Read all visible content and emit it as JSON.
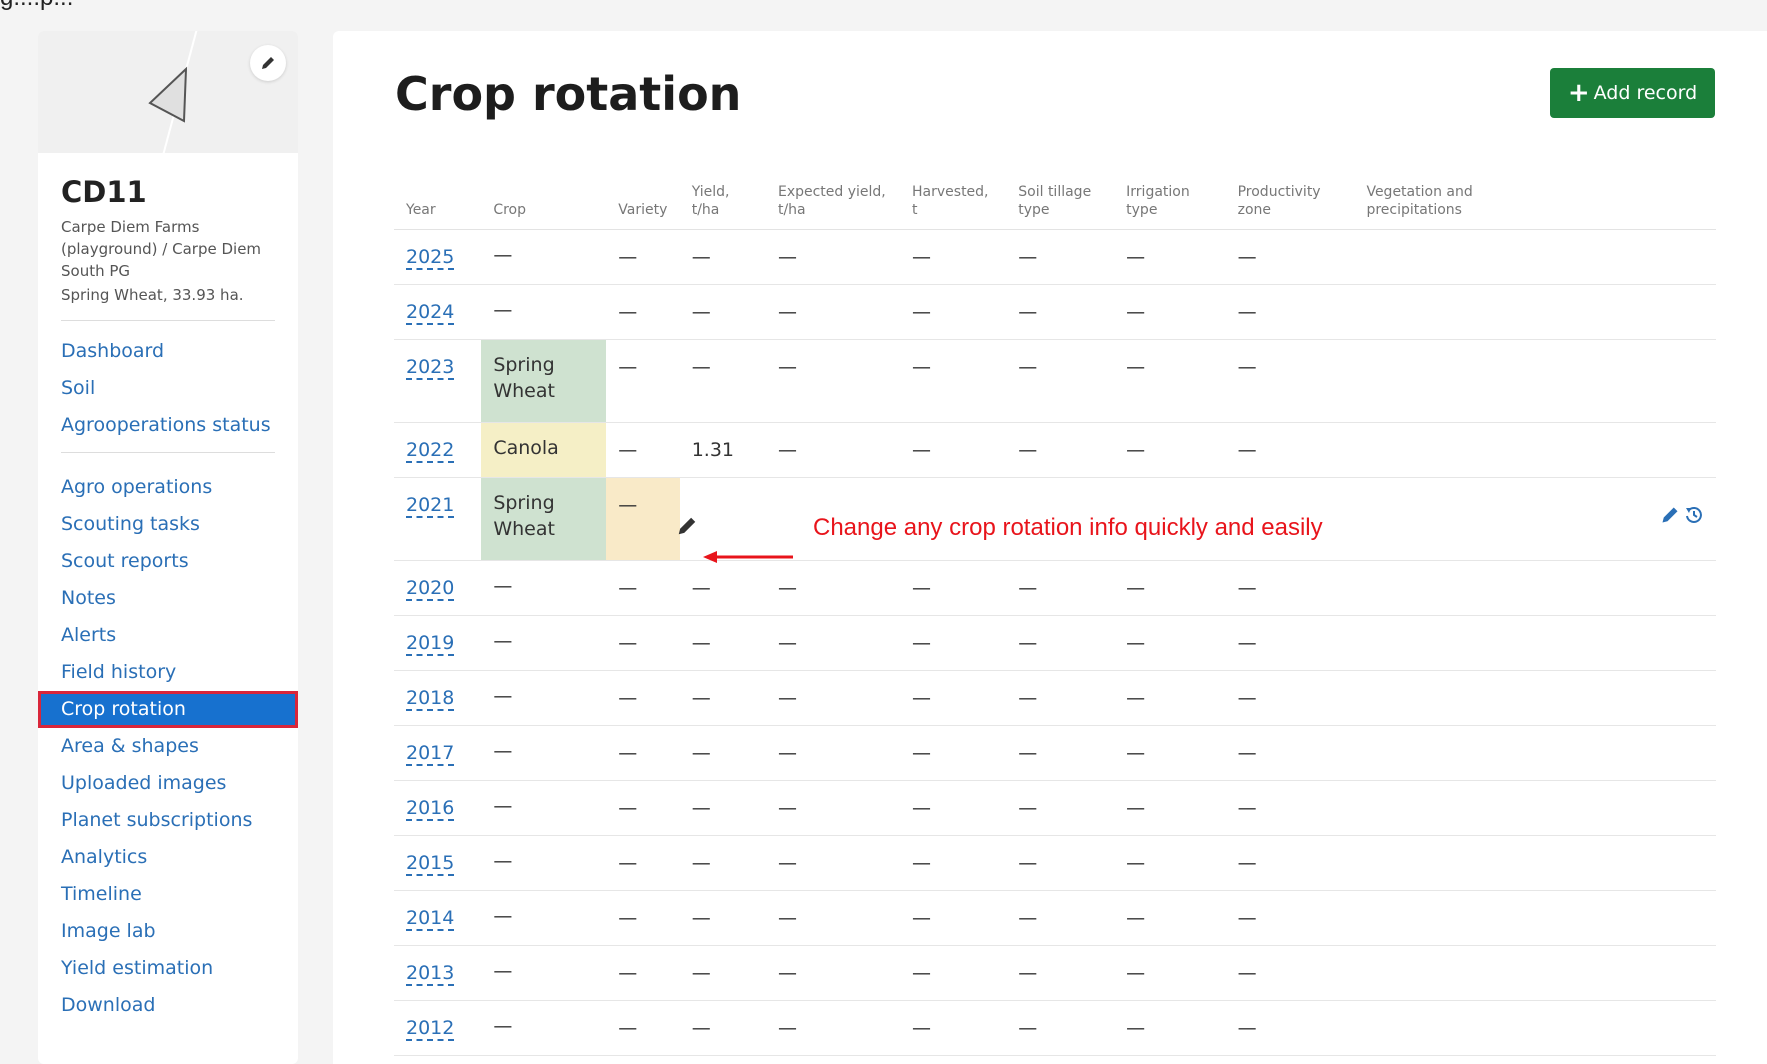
{
  "top_clip": "g....p...",
  "sidebar": {
    "field_name": "CD11",
    "meta_line1": "Carpe Diem Farms",
    "meta_line2": "(playground) / Carpe Diem",
    "meta_line3": "South PG",
    "meta_line4": "Spring Wheat, 33.93 ha.",
    "group1": [
      {
        "label": "Dashboard"
      },
      {
        "label": "Soil"
      },
      {
        "label": "Agrooperations status"
      }
    ],
    "group2": [
      {
        "label": "Agro operations"
      },
      {
        "label": "Scouting tasks"
      },
      {
        "label": "Scout reports"
      },
      {
        "label": "Notes"
      },
      {
        "label": "Alerts"
      },
      {
        "label": "Field history"
      },
      {
        "label": "Crop rotation",
        "active": true
      },
      {
        "label": "Area & shapes"
      },
      {
        "label": "Uploaded images"
      },
      {
        "label": "Planet subscriptions"
      },
      {
        "label": "Analytics"
      },
      {
        "label": "Timeline"
      },
      {
        "label": "Image lab"
      },
      {
        "label": "Yield estimation"
      },
      {
        "label": "Download"
      }
    ]
  },
  "main": {
    "title": "Crop rotation",
    "add_button": "Add record",
    "annotation": "Change any crop rotation info quickly and easily",
    "columns": [
      {
        "l1": "",
        "l2": "Year"
      },
      {
        "l1": "",
        "l2": "Crop"
      },
      {
        "l1": "",
        "l2": "Variety"
      },
      {
        "l1": "Yield,",
        "l2": "t/ha"
      },
      {
        "l1": "Expected yield,",
        "l2": "t/ha"
      },
      {
        "l1": "Harvested,",
        "l2": "t"
      },
      {
        "l1": "Soil tillage",
        "l2": "type"
      },
      {
        "l1": "Irrigation",
        "l2": "type"
      },
      {
        "l1": "Productivity",
        "l2": "zone"
      },
      {
        "l1": "Vegetation and",
        "l2": "precipitations"
      }
    ],
    "rows": [
      {
        "year": "2025",
        "crop": "—",
        "variety": "—",
        "yield": "—",
        "expected": "—",
        "harvested": "—",
        "tillage": "—",
        "irrigation": "—",
        "zone": "—"
      },
      {
        "year": "2024",
        "crop": "—",
        "variety": "—",
        "yield": "—",
        "expected": "—",
        "harvested": "—",
        "tillage": "—",
        "irrigation": "—",
        "zone": "—"
      },
      {
        "year": "2023",
        "crop": "Spring Wheat",
        "variety": "—",
        "yield": "—",
        "expected": "—",
        "harvested": "—",
        "tillage": "—",
        "irrigation": "—",
        "zone": "—"
      },
      {
        "year": "2022",
        "crop": "Canola",
        "variety": "—",
        "yield": "1.31",
        "expected": "—",
        "harvested": "—",
        "tillage": "—",
        "irrigation": "—",
        "zone": "—"
      },
      {
        "year": "2021",
        "crop": "Spring Wheat",
        "variety": "—",
        "yield": "",
        "expected": "",
        "harvested": "",
        "tillage": "",
        "irrigation": "",
        "zone": ""
      },
      {
        "year": "2020",
        "crop": "—",
        "variety": "—",
        "yield": "—",
        "expected": "—",
        "harvested": "—",
        "tillage": "—",
        "irrigation": "—",
        "zone": "—"
      },
      {
        "year": "2019",
        "crop": "—",
        "variety": "—",
        "yield": "—",
        "expected": "—",
        "harvested": "—",
        "tillage": "—",
        "irrigation": "—",
        "zone": "—"
      },
      {
        "year": "2018",
        "crop": "—",
        "variety": "—",
        "yield": "—",
        "expected": "—",
        "harvested": "—",
        "tillage": "—",
        "irrigation": "—",
        "zone": "—"
      },
      {
        "year": "2017",
        "crop": "—",
        "variety": "—",
        "yield": "—",
        "expected": "—",
        "harvested": "—",
        "tillage": "—",
        "irrigation": "—",
        "zone": "—"
      },
      {
        "year": "2016",
        "crop": "—",
        "variety": "—",
        "yield": "—",
        "expected": "—",
        "harvested": "—",
        "tillage": "—",
        "irrigation": "—",
        "zone": "—"
      },
      {
        "year": "2015",
        "crop": "—",
        "variety": "—",
        "yield": "—",
        "expected": "—",
        "harvested": "—",
        "tillage": "—",
        "irrigation": "—",
        "zone": "—"
      },
      {
        "year": "2014",
        "crop": "—",
        "variety": "—",
        "yield": "—",
        "expected": "—",
        "harvested": "—",
        "tillage": "—",
        "irrigation": "—",
        "zone": "—"
      },
      {
        "year": "2013",
        "crop": "—",
        "variety": "—",
        "yield": "—",
        "expected": "—",
        "harvested": "—",
        "tillage": "—",
        "irrigation": "—",
        "zone": "—"
      },
      {
        "year": "2012",
        "crop": "—",
        "variety": "—",
        "yield": "—",
        "expected": "—",
        "harvested": "—",
        "tillage": "—",
        "irrigation": "—",
        "zone": "—"
      }
    ]
  },
  "colors": {
    "accent": "#2a6fb6",
    "active_nav": "#1771cf",
    "highlight_border": "#d9263a",
    "add_button": "#1b7f3a",
    "spring_wheat": "#cfe2d0",
    "canola": "#f5efc6",
    "annotation": "#e8141b"
  },
  "icons": {
    "thumb_edit": "pencil-icon",
    "row_edit": "pencil-icon",
    "row_history": "history-icon",
    "add": "plus-icon"
  }
}
